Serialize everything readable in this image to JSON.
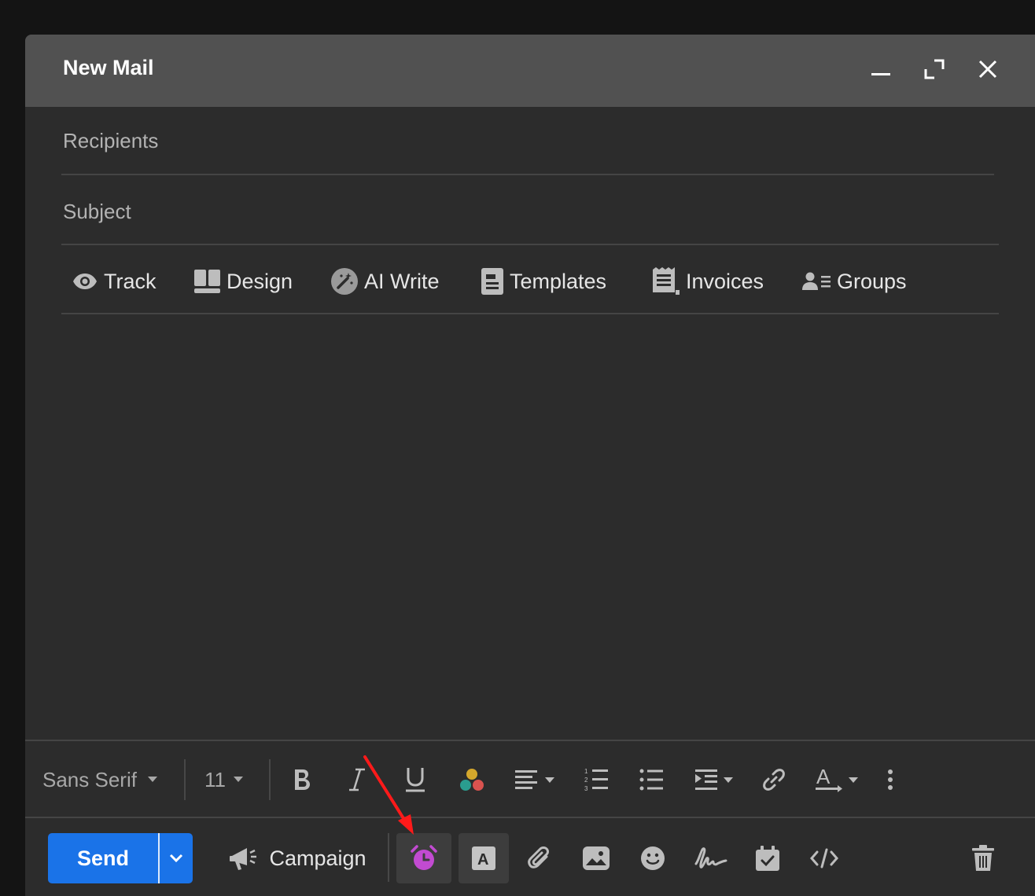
{
  "window": {
    "title": "New Mail",
    "controls": [
      "minimize-icon",
      "expand-icon",
      "close-icon"
    ]
  },
  "fields": {
    "recipients_placeholder": "Recipients",
    "subject_placeholder": "Subject"
  },
  "toolbar": {
    "items": [
      {
        "label": "Track",
        "icon": "eye-icon"
      },
      {
        "label": "Design",
        "icon": "layout-icon"
      },
      {
        "label": "AI Write",
        "icon": "magic-wand-icon"
      },
      {
        "label": "Templates",
        "icon": "template-icon"
      },
      {
        "label": "Invoices",
        "icon": "receipt-icon"
      },
      {
        "label": "Groups",
        "icon": "group-list-icon"
      }
    ]
  },
  "format": {
    "font_family": "Sans Serif",
    "font_size": "11",
    "buttons": [
      "bold-icon",
      "italic-icon",
      "underline-icon",
      "color-palette-icon",
      "align-icon",
      "numbered-list-icon",
      "bulleted-list-icon",
      "indent-icon",
      "link-icon",
      "text-format-icon",
      "more-options-icon"
    ]
  },
  "bottom": {
    "send_label": "Send",
    "campaign_label": "Campaign",
    "schedule_icon_color": "#c24bd1",
    "accent_color": "#1a73e8",
    "annotation_color": "#ff1a1a",
    "icons": [
      "megaphone-icon",
      "alarm-clock-icon",
      "text-style-icon",
      "attachment-icon",
      "image-icon",
      "emoji-icon",
      "signature-icon",
      "calendar-check-icon",
      "code-icon",
      "trash-icon"
    ]
  }
}
